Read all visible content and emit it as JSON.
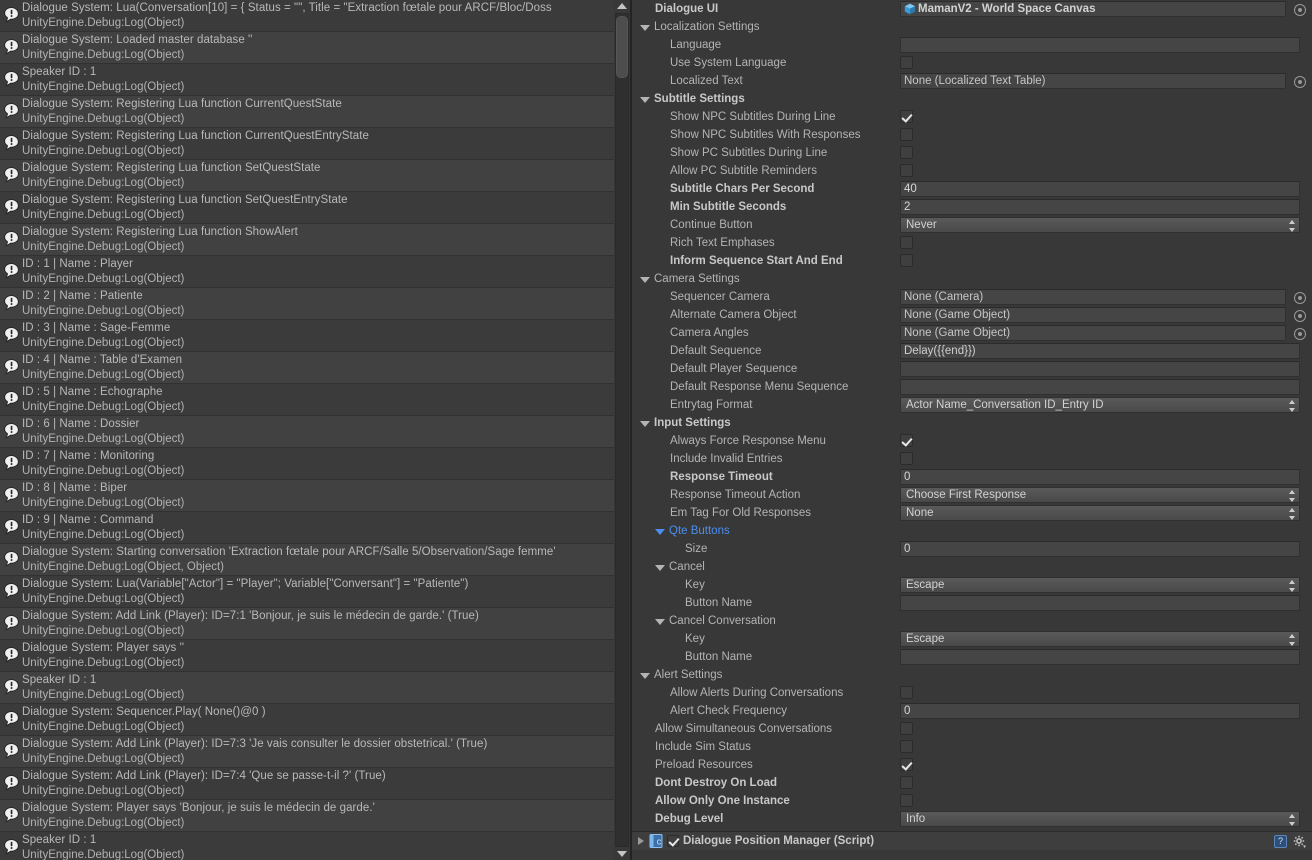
{
  "console": {
    "sublabel_default": "UnityEngine.Debug:Log(Object)",
    "entries": [
      {
        "msg": "Dialogue System: Lua(Conversation[10] = { Status = \"\", Title = \"Extraction fœtale pour ARCF/Bloc/Doss",
        "sub": "UnityEngine.Debug:Log(Object)"
      },
      {
        "msg": "Dialogue System: Loaded master database ''",
        "sub": "UnityEngine.Debug:Log(Object)"
      },
      {
        "msg": "Speaker ID : 1",
        "sub": "UnityEngine.Debug:Log(Object)"
      },
      {
        "msg": "Dialogue System: Registering Lua function CurrentQuestState",
        "sub": "UnityEngine.Debug:Log(Object)"
      },
      {
        "msg": "Dialogue System: Registering Lua function CurrentQuestEntryState",
        "sub": "UnityEngine.Debug:Log(Object)"
      },
      {
        "msg": "Dialogue System: Registering Lua function SetQuestState",
        "sub": "UnityEngine.Debug:Log(Object)"
      },
      {
        "msg": "Dialogue System: Registering Lua function SetQuestEntryState",
        "sub": "UnityEngine.Debug:Log(Object)"
      },
      {
        "msg": "Dialogue System: Registering Lua function ShowAlert",
        "sub": "UnityEngine.Debug:Log(Object)"
      },
      {
        "msg": "ID : 1 | Name : Player",
        "sub": "UnityEngine.Debug:Log(Object)"
      },
      {
        "msg": "ID : 2 | Name : Patiente",
        "sub": "UnityEngine.Debug:Log(Object)"
      },
      {
        "msg": "ID : 3 | Name : Sage-Femme",
        "sub": "UnityEngine.Debug:Log(Object)"
      },
      {
        "msg": "ID : 4 | Name : Table d'Examen",
        "sub": "UnityEngine.Debug:Log(Object)"
      },
      {
        "msg": "ID : 5 | Name : Echographe",
        "sub": "UnityEngine.Debug:Log(Object)"
      },
      {
        "msg": "ID : 6 | Name : Dossier",
        "sub": "UnityEngine.Debug:Log(Object)"
      },
      {
        "msg": "ID : 7 | Name : Monitoring",
        "sub": "UnityEngine.Debug:Log(Object)"
      },
      {
        "msg": "ID : 8 | Name : Biper",
        "sub": "UnityEngine.Debug:Log(Object)"
      },
      {
        "msg": "ID : 9 | Name : Command",
        "sub": "UnityEngine.Debug:Log(Object)"
      },
      {
        "msg": "Dialogue System: Starting conversation 'Extraction fœtale pour ARCF/Salle 5/Observation/Sage femme'",
        "sub": "UnityEngine.Debug:Log(Object, Object)"
      },
      {
        "msg": "Dialogue System: Lua(Variable[\"Actor\"] = \"Player\"; Variable[\"Conversant\"] = \"Patiente\")",
        "sub": "UnityEngine.Debug:Log(Object)"
      },
      {
        "msg": "Dialogue System: Add Link (Player): ID=7:1 'Bonjour, je suis le médecin de garde.' (True)",
        "sub": "UnityEngine.Debug:Log(Object)"
      },
      {
        "msg": "Dialogue System: Player says ''",
        "sub": "UnityEngine.Debug:Log(Object)"
      },
      {
        "msg": "Speaker ID : 1",
        "sub": "UnityEngine.Debug:Log(Object)"
      },
      {
        "msg": "Dialogue System: Sequencer.Play( None()@0 )",
        "sub": "UnityEngine.Debug:Log(Object)"
      },
      {
        "msg": "Dialogue System: Add Link (Player): ID=7:3 'Je vais consulter le dossier obstetrical.' (True)",
        "sub": "UnityEngine.Debug:Log(Object)"
      },
      {
        "msg": "Dialogue System: Add Link (Player): ID=7:4 'Que se passe-t-il ?' (True)",
        "sub": "UnityEngine.Debug:Log(Object)"
      },
      {
        "msg": "Dialogue System: Player says 'Bonjour, je suis le médecin de garde.'",
        "sub": "UnityEngine.Debug:Log(Object)"
      },
      {
        "msg": "Speaker ID : 1",
        "sub": "UnityEngine.Debug:Log(Object)"
      }
    ]
  },
  "inspector": {
    "rows": [
      {
        "kind": "field",
        "indent": 0,
        "label": "Dialogue UI",
        "bold": true,
        "control": "objectref",
        "value": "MamanV2 - World Space Canvas",
        "icon": "prefab-cube-icon",
        "assigned": true,
        "picker": true
      },
      {
        "kind": "foldout",
        "indent": 0,
        "label": "Localization Settings",
        "bold": false,
        "open": true
      },
      {
        "kind": "field",
        "indent": 1,
        "label": "Language",
        "control": "text",
        "value": ""
      },
      {
        "kind": "field",
        "indent": 1,
        "label": "Use System Language",
        "control": "checkbox",
        "checked": false
      },
      {
        "kind": "field",
        "indent": 1,
        "label": "Localized Text",
        "control": "objectref",
        "value": "None (Localized Text Table)",
        "picker": true
      },
      {
        "kind": "foldout",
        "indent": 0,
        "label": "Subtitle Settings",
        "bold": true,
        "open": true
      },
      {
        "kind": "field",
        "indent": 1,
        "label": "Show NPC Subtitles During Line",
        "control": "checkbox",
        "checked": true
      },
      {
        "kind": "field",
        "indent": 1,
        "label": "Show NPC Subtitles With Responses",
        "control": "checkbox",
        "checked": false
      },
      {
        "kind": "field",
        "indent": 1,
        "label": "Show PC Subtitles During Line",
        "control": "checkbox",
        "checked": false
      },
      {
        "kind": "field",
        "indent": 1,
        "label": "Allow PC Subtitle Reminders",
        "control": "checkbox",
        "checked": false
      },
      {
        "kind": "field",
        "indent": 1,
        "label": "Subtitle Chars Per Second",
        "bold": true,
        "control": "number",
        "value": "40"
      },
      {
        "kind": "field",
        "indent": 1,
        "label": "Min Subtitle Seconds",
        "bold": true,
        "control": "number",
        "value": "2"
      },
      {
        "kind": "field",
        "indent": 1,
        "label": "Continue Button",
        "control": "dropdown",
        "value": "Never"
      },
      {
        "kind": "field",
        "indent": 1,
        "label": "Rich Text Emphases",
        "control": "checkbox",
        "checked": false
      },
      {
        "kind": "field",
        "indent": 1,
        "label": "Inform Sequence Start And End",
        "bold": true,
        "control": "checkbox",
        "checked": false
      },
      {
        "kind": "foldout",
        "indent": 0,
        "label": "Camera Settings",
        "bold": false,
        "open": true
      },
      {
        "kind": "field",
        "indent": 1,
        "label": "Sequencer Camera",
        "control": "objectref",
        "value": "None (Camera)",
        "picker": true
      },
      {
        "kind": "field",
        "indent": 1,
        "label": "Alternate Camera Object",
        "control": "objectref",
        "value": "None (Game Object)",
        "picker": true
      },
      {
        "kind": "field",
        "indent": 1,
        "label": "Camera Angles",
        "control": "objectref",
        "value": "None (Game Object)",
        "picker": true
      },
      {
        "kind": "field",
        "indent": 1,
        "label": "Default Sequence",
        "control": "text",
        "value": "Delay({{end}})"
      },
      {
        "kind": "field",
        "indent": 1,
        "label": "Default Player Sequence",
        "control": "text",
        "value": ""
      },
      {
        "kind": "field",
        "indent": 1,
        "label": "Default Response Menu Sequence",
        "control": "text",
        "value": ""
      },
      {
        "kind": "field",
        "indent": 1,
        "label": "Entrytag Format",
        "control": "dropdown",
        "value": "Actor Name_Conversation ID_Entry ID"
      },
      {
        "kind": "foldout",
        "indent": 0,
        "label": "Input Settings",
        "bold": true,
        "open": true
      },
      {
        "kind": "field",
        "indent": 1,
        "label": "Always Force Response Menu",
        "control": "checkbox",
        "checked": true
      },
      {
        "kind": "field",
        "indent": 1,
        "label": "Include Invalid Entries",
        "control": "checkbox",
        "checked": false
      },
      {
        "kind": "field",
        "indent": 1,
        "label": "Response Timeout",
        "bold": true,
        "control": "number",
        "value": "0"
      },
      {
        "kind": "field",
        "indent": 1,
        "label": "Response Timeout Action",
        "control": "dropdown",
        "value": "Choose First Response"
      },
      {
        "kind": "field",
        "indent": 1,
        "label": "Em Tag For Old Responses",
        "control": "dropdown",
        "value": "None"
      },
      {
        "kind": "foldout",
        "indent": 1,
        "label": "Qte Buttons",
        "blue": true,
        "open": true
      },
      {
        "kind": "field",
        "indent": 2,
        "label": "Size",
        "control": "number",
        "value": "0"
      },
      {
        "kind": "foldout",
        "indent": 1,
        "label": "Cancel",
        "open": true
      },
      {
        "kind": "field",
        "indent": 2,
        "label": "Key",
        "control": "dropdown",
        "value": "Escape"
      },
      {
        "kind": "field",
        "indent": 2,
        "label": "Button Name",
        "control": "text",
        "value": ""
      },
      {
        "kind": "foldout",
        "indent": 1,
        "label": "Cancel Conversation",
        "open": true
      },
      {
        "kind": "field",
        "indent": 2,
        "label": "Key",
        "control": "dropdown",
        "value": "Escape"
      },
      {
        "kind": "field",
        "indent": 2,
        "label": "Button Name",
        "control": "text",
        "value": ""
      },
      {
        "kind": "foldout",
        "indent": 0,
        "label": "Alert Settings",
        "open": true
      },
      {
        "kind": "field",
        "indent": 1,
        "label": "Allow Alerts During Conversations",
        "control": "checkbox",
        "checked": false
      },
      {
        "kind": "field",
        "indent": 1,
        "label": "Alert Check Frequency",
        "control": "number",
        "value": "0"
      },
      {
        "kind": "field",
        "indent": 0,
        "label": "Allow Simultaneous Conversations",
        "control": "checkbox",
        "checked": false
      },
      {
        "kind": "field",
        "indent": 0,
        "label": "Include Sim Status",
        "control": "checkbox",
        "checked": false
      },
      {
        "kind": "field",
        "indent": 0,
        "label": "Preload Resources",
        "control": "checkbox",
        "checked": true
      },
      {
        "kind": "field",
        "indent": 0,
        "label": "Dont Destroy On Load",
        "bold": true,
        "control": "checkbox",
        "checked": false
      },
      {
        "kind": "field",
        "indent": 0,
        "label": "Allow Only One Instance",
        "bold": true,
        "control": "checkbox",
        "checked": false
      },
      {
        "kind": "field",
        "indent": 0,
        "label": "Debug Level",
        "bold": true,
        "control": "dropdown",
        "value": "Info"
      }
    ],
    "component_header": {
      "title": "Dialogue Position Manager (Script)",
      "enabled": true,
      "help_label": "?",
      "icon": "cs-script-icon"
    }
  },
  "colors": {
    "background": "#383838",
    "row_odd": "#3b3b3b",
    "row_even": "#414141",
    "field_bg": "#454545",
    "accent_blue": "#4b8ef0",
    "text": "#b4b4b4"
  }
}
